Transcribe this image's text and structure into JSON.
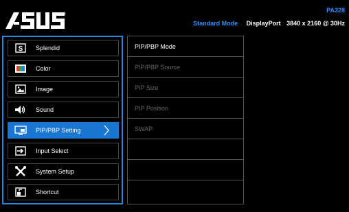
{
  "header": {
    "model": "PA328",
    "mode": "Standard Mode",
    "port": "DisplayPort",
    "resolution": "3840 x 2160 @ 30Hz",
    "logo_alt": "ASUS"
  },
  "menu": {
    "items": [
      {
        "label": "Splendid",
        "icon": "splendid-icon"
      },
      {
        "label": "Color",
        "icon": "color-icon"
      },
      {
        "label": "Image",
        "icon": "image-icon"
      },
      {
        "label": "Sound",
        "icon": "sound-icon"
      },
      {
        "label": "PIP/PBP Setting",
        "icon": "pip-pbp-icon",
        "active": true
      },
      {
        "label": "Input Select",
        "icon": "input-select-icon"
      },
      {
        "label": "System Setup",
        "icon": "system-setup-icon"
      },
      {
        "label": "Shortcut",
        "icon": "shortcut-icon"
      }
    ]
  },
  "submenu": {
    "items": [
      {
        "label": "PIP/PBP Mode",
        "enabled": true
      },
      {
        "label": "PIP/PBP Source",
        "enabled": false
      },
      {
        "label": "PIP Size",
        "enabled": false
      },
      {
        "label": "PIP Position",
        "enabled": false
      },
      {
        "label": "SWAP",
        "enabled": false
      },
      {
        "label": "",
        "enabled": false
      },
      {
        "label": "",
        "enabled": false
      },
      {
        "label": "",
        "enabled": false
      }
    ]
  },
  "colors": {
    "accent": "#1976d2",
    "highlight_text": "#2e8fff"
  }
}
